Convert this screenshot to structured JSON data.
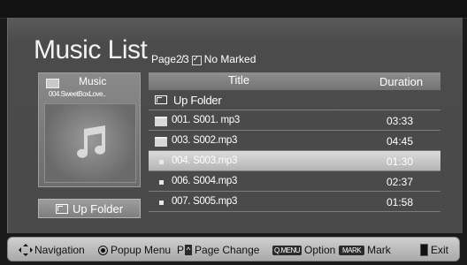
{
  "page": {
    "title": "Music List",
    "page_label": "Page",
    "page_number": "2/3",
    "mark_status": "No Marked"
  },
  "thumbnail": {
    "folder_name": "Music",
    "file_name": "004.SweetBoxLove.."
  },
  "left_button": {
    "label": "Up Folder"
  },
  "list": {
    "header_title": "Title",
    "header_duration": "Duration",
    "rows": [
      {
        "type": "upfolder",
        "name": "Up Folder",
        "duration": ""
      },
      {
        "type": "folder",
        "name": "001. S001. mp3",
        "duration": "03:33"
      },
      {
        "type": "folder",
        "name": "003. S002.mp3",
        "duration": "04:45"
      },
      {
        "type": "file",
        "name": "004. S003.mp3",
        "duration": "01:30"
      },
      {
        "type": "file",
        "name": "006. S004.mp3",
        "duration": "02:37"
      },
      {
        "type": "file",
        "name": "007. S005.mp3",
        "duration": "01:58"
      }
    ],
    "selected_index": 3
  },
  "footer": {
    "navigation": "Navigation",
    "popup_menu": "Popup Menu",
    "page_key": "P",
    "page_change": "Page Change",
    "qmenu_badge": "Q.MENU",
    "option": "Option",
    "mark_badge": "MARK",
    "mark": "Mark",
    "exit": "Exit"
  },
  "colors": {
    "background": "#1a1a1a",
    "panel": "#4b4b4b",
    "selected_row": "#c8c8c8",
    "footer": "#bdbdbd"
  }
}
